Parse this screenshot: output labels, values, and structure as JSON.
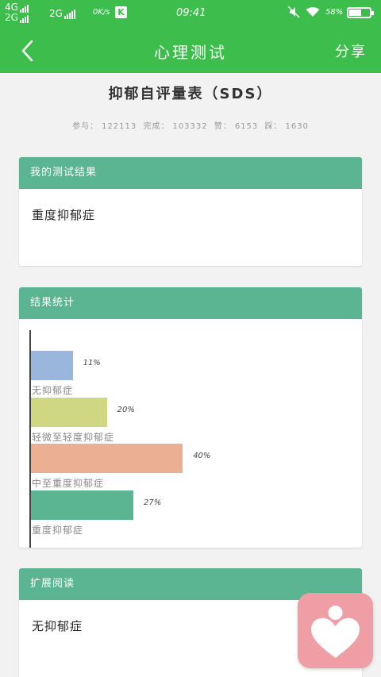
{
  "status_bar": {
    "net1": "4G",
    "net2": "2G",
    "net3": "2G",
    "speed": "0K/s",
    "k_badge": "K",
    "time": "09:41",
    "battery": "58%",
    "battery_level": 0.58
  },
  "header": {
    "title": "心理测试",
    "share_label": "分享",
    "bg_color": "#3dbd4c"
  },
  "test": {
    "title": "抑郁自评量表（SDS）",
    "stats": {
      "participants_label": "参与：",
      "participants": "122113",
      "completed_label": "完成：",
      "completed": "103332",
      "likes_label": "赞：",
      "likes": "6153",
      "follows_label": "踩：",
      "follows": "1630"
    }
  },
  "my_result": {
    "heading": "我的测试结果",
    "value": "重度抑郁症"
  },
  "result_stats": {
    "heading": "结果统计"
  },
  "chart_data": {
    "type": "bar",
    "orientation": "horizontal",
    "categories": [
      "无抑郁症",
      "轻微至轻度抑郁症",
      "中至重度抑郁症",
      "重度抑郁症"
    ],
    "values": [
      11,
      20,
      40,
      27
    ],
    "value_labels": [
      "11%",
      "20%",
      "40%",
      "27%"
    ],
    "colors": [
      "#9ab6dc",
      "#cfd782",
      "#ebaf93",
      "#5bb593"
    ],
    "xlim": [
      0,
      100
    ]
  },
  "extended_reading": {
    "heading": "扩展阅读",
    "item": "无抑郁症"
  },
  "fab": {
    "icon": "heart-person-icon",
    "color": "#ef9ea5"
  }
}
